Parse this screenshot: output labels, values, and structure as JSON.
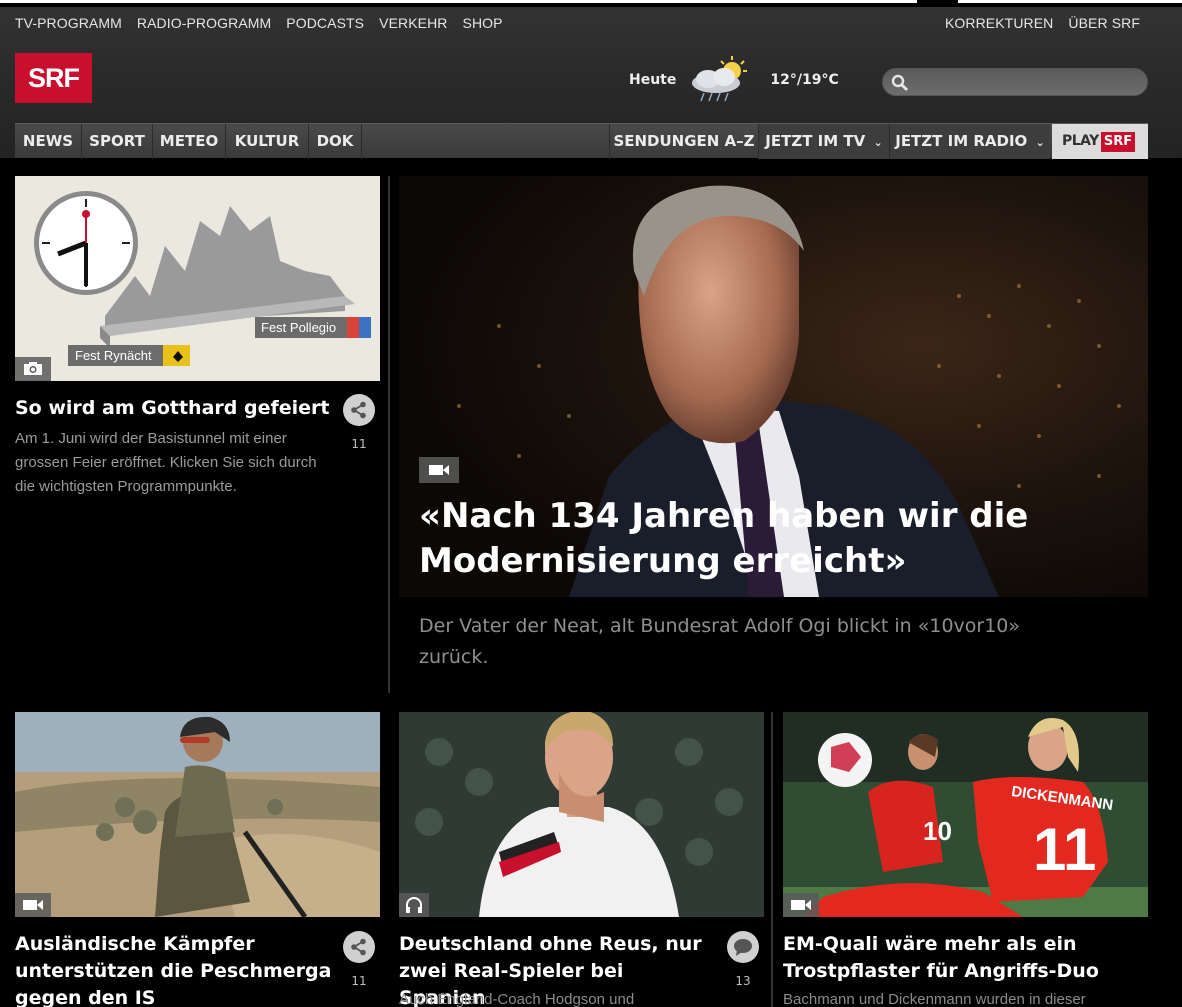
{
  "utility_nav": {
    "left": [
      "TV-PROGRAMM",
      "RADIO-PROGRAMM",
      "PODCASTS",
      "VERKEHR",
      "SHOP"
    ],
    "right": [
      "KORREKTUREN",
      "ÜBER SRF"
    ]
  },
  "logo": {
    "text": "SRF",
    "color": "#c8102e"
  },
  "weather": {
    "day": "Heute",
    "icon": "cloud-sun-rain-icon",
    "temp": "12°/19°C"
  },
  "search": {
    "placeholder": "",
    "icon": "search-icon"
  },
  "main_nav": {
    "left": [
      "NEWS",
      "SPORT",
      "METEO",
      "KULTUR",
      "DOK"
    ],
    "right": [
      "SENDUNGEN A–Z",
      "JETZT IM TV",
      "JETZT IM RADIO"
    ],
    "play": {
      "label1": "PLAY",
      "label2": "SRF"
    }
  },
  "teasers": {
    "gotthard": {
      "headline": "So wird am Gotthard gefeiert",
      "lead": "Am 1. Juni wird der Basistunnel mit einer grossen Feier eröffnet. Klicken Sie sich durch die wichtigsten Programmpunkte.",
      "media": "camera-icon",
      "share_count": "11",
      "img_labels": {
        "right": "Fest Pollegio",
        "left": "Fest Rynächt"
      }
    },
    "ogi": {
      "headline": "«Nach 134 Jahren haben wir die Modernisierung erreicht»",
      "lead": "Der Vater der Neat, alt Bundesrat Adolf Ogi blickt in «10vor10» zurück.",
      "media": "video-icon"
    },
    "peschmerga": {
      "headline": "Ausländische Kämpfer unterstützen die Peschmerga gegen den IS",
      "media": "video-icon",
      "share_count": "11"
    },
    "reus": {
      "headline": "Deutschland ohne Reus, nur zwei Real-Spieler bei Spanien",
      "lead": "Auch England-Coach Hodgson und",
      "media": "audio-icon",
      "comment_count": "13"
    },
    "emquali": {
      "headline": "EM-Quali wäre mehr als ein Trostpflaster für Angriffs-Duo",
      "lead": "Bachmann und Dickenmann wurden in dieser",
      "media": "video-icon",
      "img_label": "DICKENMANN"
    }
  }
}
